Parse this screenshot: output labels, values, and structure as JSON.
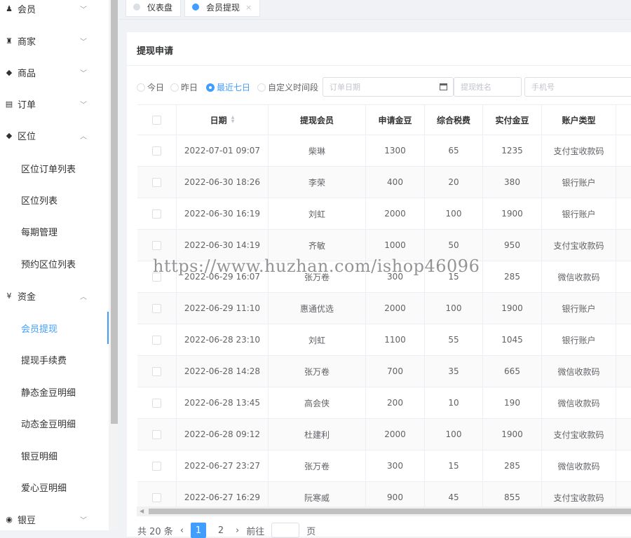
{
  "sidebar": {
    "menu": [
      {
        "label": "会员",
        "icon": "user-icon",
        "arrow": "﹀"
      },
      {
        "label": "商家",
        "icon": "shop-icon",
        "arrow": "﹀"
      },
      {
        "label": "商品",
        "icon": "tag-icon",
        "arrow": "﹀"
      },
      {
        "label": "订单",
        "icon": "list-icon",
        "arrow": "﹀"
      },
      {
        "label": "区位",
        "icon": "tag-icon",
        "arrow": "︿"
      }
    ],
    "quwei_sub": [
      "区位订单列表",
      "区位列表",
      "每期管理",
      "预约区位列表"
    ],
    "zijin": {
      "label": "资金",
      "icon": "yen-icon",
      "icon_glyph": "¥",
      "arrow": "︿"
    },
    "zijin_sub": [
      "会员提现",
      "提现手续费",
      "静态金豆明细",
      "动态金豆明细",
      "银豆明细",
      "爱心豆明细"
    ],
    "active_sub": "会员提现",
    "yindou": {
      "label": "银豆",
      "icon": "circle-dot-icon",
      "icon_glyph": "◉",
      "arrow": "﹀"
    }
  },
  "tabs": [
    {
      "label": "仪表盘",
      "dot_color": "#dcdfe6"
    },
    {
      "label": "会员提现",
      "dot_color": "#409eff",
      "close": "×"
    }
  ],
  "card": {
    "title": "提现申请"
  },
  "filters": {
    "radios": [
      "今日",
      "昨日",
      "最近七日",
      "自定义时间段"
    ],
    "checked": "最近七日",
    "date_placeholder": "订单日期",
    "name_placeholder": "提现姓名",
    "phone_placeholder": "手机号"
  },
  "table": {
    "headers": [
      "日期",
      "提现会员",
      "申请金豆",
      "综合税费",
      "实付金豆",
      "账户类型"
    ],
    "rows": [
      [
        "2022-07-01 09:07",
        "柴琳",
        "1300",
        "65",
        "1235",
        "支付宝收款码"
      ],
      [
        "2022-06-30 18:26",
        "李荣",
        "400",
        "20",
        "380",
        "银行账户"
      ],
      [
        "2022-06-30 16:19",
        "刘虹",
        "2000",
        "100",
        "1900",
        "银行账户"
      ],
      [
        "2022-06-30 14:19",
        "齐敏",
        "1000",
        "50",
        "950",
        "支付宝收款码"
      ],
      [
        "2022-06-29 16:07",
        "张万卷",
        "300",
        "15",
        "285",
        "微信收款码"
      ],
      [
        "2022-06-29 11:10",
        "惠通优选",
        "2000",
        "100",
        "1900",
        "银行账户"
      ],
      [
        "2022-06-28 23:10",
        "刘虹",
        "1100",
        "55",
        "1045",
        "银行账户"
      ],
      [
        "2022-06-28 14:28",
        "张万卷",
        "700",
        "35",
        "665",
        "微信收款码"
      ],
      [
        "2022-06-28 13:45",
        "高会侠",
        "200",
        "10",
        "190",
        "微信收款码"
      ],
      [
        "2022-06-28 09:12",
        "杜建利",
        "2000",
        "100",
        "1900",
        "支付宝收款码"
      ],
      [
        "2022-06-27 23:27",
        "张万卷",
        "300",
        "15",
        "285",
        "微信收款码"
      ],
      [
        "2022-06-27 16:29",
        "阮寒威",
        "900",
        "45",
        "855",
        "支付宝收款码"
      ]
    ]
  },
  "watermark": "https://www.huzhan.com/ishop46096",
  "pagination": {
    "total_text": "共 20 条",
    "prev": "‹",
    "pages": [
      "1",
      "2"
    ],
    "active": "1",
    "next": "›",
    "goto": "前往",
    "unit": "页"
  }
}
